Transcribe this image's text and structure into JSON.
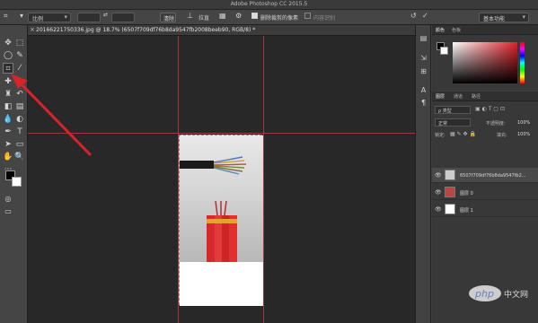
{
  "app": {
    "title": "Adobe Photoshop CC 2015.5"
  },
  "options_bar": {
    "ratio": "比例",
    "clear": "清除",
    "straighten": "拉直",
    "delete_cropped": "删除裁剪的像素",
    "content_aware": "内容识别",
    "workspace": "基本功能"
  },
  "document": {
    "tab_title": "20166221750336.jpg @ 18.7% (6507f709df76b8da9547fb2008beeb90, RGB/8) *"
  },
  "color_panel": {
    "tabs": [
      "颜色",
      "色板"
    ]
  },
  "layers_panel": {
    "tabs": [
      "图层",
      "通道",
      "路径"
    ],
    "filter_kind": "ρ 类型",
    "blend_mode": "正常",
    "opacity_label": "不透明度:",
    "opacity_value": "100%",
    "lock_label": "锁定:",
    "fill_label": "填充:",
    "fill_value": "100%",
    "layers": [
      {
        "name": "6507f709df76b8da9547fb2..."
      },
      {
        "name": "图层 0"
      },
      {
        "name": "图层 1"
      }
    ]
  },
  "watermark": {
    "text": "php 中文网"
  },
  "colors": {
    "guide": "#b8393f",
    "annotation_arrow": "#d8232a",
    "accent": "#3b7bd6"
  }
}
